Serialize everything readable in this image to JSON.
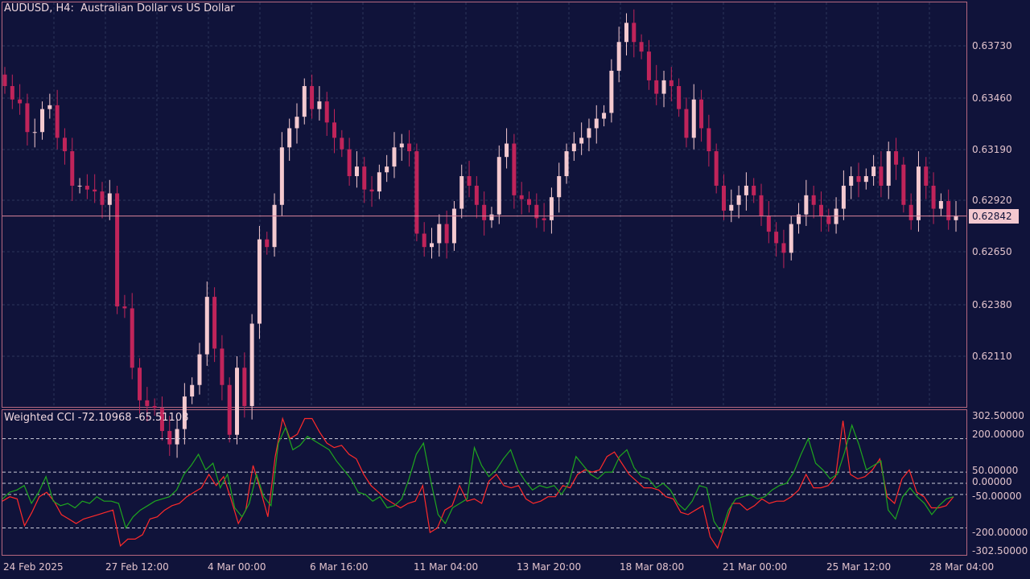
{
  "chart": {
    "symbol_title": "AUDUSD, H4:  Australian Dollar vs US Dollar",
    "current_price": "0.62842",
    "colors": {
      "background": "#10133a",
      "bull": "#f4c9cf",
      "bear": "#c0245a",
      "grid": "#2b3459",
      "cci_red": "#ff2a2a",
      "cci_green": "#1fa61f"
    }
  },
  "price_axis": [
    "0.63730",
    "0.63460",
    "0.63190",
    "0.62920",
    "0.62650",
    "0.62380",
    "0.62110"
  ],
  "indicator": {
    "title": "Weighted CCI -72.10968 -65.51108",
    "axis": [
      "302.50000",
      "200.00000",
      "50.00000",
      "0.00000",
      "-50.00000",
      "-200.00000",
      "-302.50000"
    ]
  },
  "time_axis": [
    "24 Feb 2025",
    "27 Feb 12:00",
    "4 Mar 00:00",
    "6 Mar 16:00",
    "11 Mar 04:00",
    "13 Mar 20:00",
    "18 Mar 08:00",
    "21 Mar 00:00",
    "25 Mar 12:00",
    "28 Mar 04:00"
  ],
  "chart_data": [
    {
      "type": "candlestick",
      "title": "AUDUSD, H4:  Australian Dollar vs US Dollar",
      "ylim": [
        0.619,
        0.639
      ],
      "candle_closes": [
        0.6352,
        0.6345,
        0.6343,
        0.6328,
        0.6328,
        0.634,
        0.6342,
        0.6325,
        0.6318,
        0.63,
        0.63,
        0.6298,
        0.6297,
        0.629,
        0.6296,
        0.6237,
        0.6236,
        0.6205,
        0.6188,
        0.6185,
        0.6184,
        0.6172,
        0.6165,
        0.6173,
        0.619,
        0.6196,
        0.6212,
        0.6242,
        0.6215,
        0.6196,
        0.617,
        0.6205,
        0.6185,
        0.6228,
        0.6272,
        0.6268,
        0.629,
        0.632,
        0.633,
        0.6336,
        0.6352,
        0.634,
        0.6344,
        0.6333,
        0.6325,
        0.6319,
        0.6305,
        0.631,
        0.6298,
        0.6297,
        0.6307,
        0.631,
        0.632,
        0.6322,
        0.6318,
        0.6275,
        0.6268,
        0.627,
        0.628,
        0.627,
        0.6288,
        0.6305,
        0.63,
        0.629,
        0.6282,
        0.6285,
        0.6315,
        0.6322,
        0.6295,
        0.6293,
        0.629,
        0.6283,
        0.6282,
        0.6294,
        0.6305,
        0.6318,
        0.6322,
        0.6325,
        0.633,
        0.6335,
        0.6338,
        0.636,
        0.6375,
        0.6385,
        0.6375,
        0.637,
        0.6355,
        0.6348,
        0.6355,
        0.6352,
        0.634,
        0.6325,
        0.6345,
        0.633,
        0.6318,
        0.63,
        0.6287,
        0.629,
        0.6295,
        0.63,
        0.6295,
        0.6284,
        0.6276,
        0.627,
        0.6265,
        0.628,
        0.6285,
        0.6295,
        0.629,
        0.6284,
        0.628,
        0.6288,
        0.63,
        0.6305,
        0.6302,
        0.6305,
        0.631,
        0.63,
        0.6318,
        0.6311,
        0.629,
        0.6282,
        0.631,
        0.63,
        0.6288,
        0.6292,
        0.6282,
        0.6284
      ]
    },
    {
      "type": "line",
      "title": "Weighted CCI -72.10968 -65.51108",
      "ylim": [
        -302.5,
        302.5
      ],
      "series": [
        {
          "name": "",
          "color": "#ff2a2a",
          "values": [
            -80,
            -60,
            -70,
            -190,
            -130,
            -60,
            -40,
            -80,
            -140,
            -160,
            -180,
            -160,
            -150,
            -140,
            -130,
            -120,
            -280,
            -250,
            -250,
            -230,
            -160,
            -150,
            -120,
            -100,
            -90,
            -60,
            -40,
            -20,
            40,
            -10,
            30,
            -70,
            -180,
            -120,
            80,
            -30,
            -150,
            120,
            290,
            200,
            220,
            290,
            290,
            230,
            180,
            160,
            170,
            130,
            110,
            40,
            -10,
            -40,
            -70,
            -90,
            -110,
            -90,
            -80,
            -10,
            -220,
            -200,
            -120,
            -100,
            -10,
            -80,
            -70,
            -90,
            10,
            40,
            -10,
            -20,
            -10,
            -70,
            -90,
            -80,
            -60,
            -60,
            -10,
            -20,
            40,
            60,
            50,
            60,
            120,
            140,
            90,
            40,
            10,
            -20,
            -20,
            -30,
            -60,
            -70,
            -130,
            -140,
            -120,
            -100,
            -240,
            -290,
            -190,
            -90,
            -90,
            -120,
            -100,
            -70,
            -90,
            -80,
            -80,
            -60,
            -30,
            40,
            -20,
            -20,
            -10,
            30,
            280,
            40,
            20,
            30,
            60,
            110,
            -60,
            -90,
            20,
            60,
            -40,
            -60,
            -110,
            -110,
            -100,
            -60
          ]
        },
        {
          "name": "",
          "color": "#1fa61f",
          "values": [
            -70,
            -40,
            -30,
            -10,
            -90,
            -40,
            30,
            -80,
            -100,
            -90,
            -110,
            -80,
            -90,
            -60,
            -80,
            -80,
            -90,
            -200,
            -150,
            -120,
            -100,
            -80,
            -70,
            -60,
            -30,
            40,
            80,
            130,
            60,
            90,
            -20,
            40,
            -110,
            -150,
            -90,
            40,
            -60,
            -100,
            180,
            250,
            150,
            170,
            210,
            190,
            170,
            150,
            100,
            60,
            20,
            -40,
            -50,
            -80,
            -60,
            -110,
            -100,
            -70,
            20,
            130,
            180,
            10,
            -140,
            -180,
            -110,
            -90,
            -70,
            160,
            80,
            30,
            60,
            110,
            150,
            60,
            10,
            -30,
            -10,
            -20,
            -10,
            -50,
            0,
            120,
            80,
            40,
            20,
            50,
            50,
            120,
            150,
            70,
            30,
            20,
            -20,
            0,
            -30,
            -90,
            -120,
            -80,
            -10,
            -20,
            -170,
            -220,
            -120,
            -70,
            -60,
            -50,
            -70,
            -60,
            -30,
            -10,
            0,
            50,
            130,
            200,
            90,
            60,
            20,
            40,
            140,
            260,
            170,
            60,
            80,
            100,
            -120,
            -160,
            -60,
            -20,
            -60,
            -90,
            -140,
            -100,
            -70,
            -60
          ]
        }
      ]
    }
  ]
}
